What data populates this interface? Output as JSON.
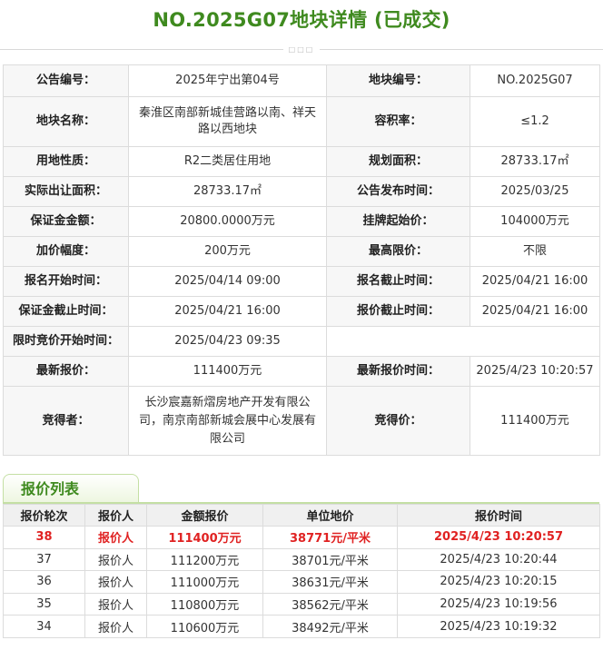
{
  "page": {
    "title": "NO.2025G07地块详情 (已成交)"
  },
  "detail": {
    "announcement_no_label": "公告编号：",
    "announcement_no": "2025年宁出第04号",
    "parcel_no_label": "地块编号：",
    "parcel_no": "NO.2025G07",
    "parcel_name_label": "地块名称：",
    "parcel_name": "秦淮区南部新城佳营路以南、祥天路以西地块",
    "plot_ratio_label": "容积率：",
    "plot_ratio": "≤1.2",
    "land_use_label": "用地性质：",
    "land_use": "R2二类居住用地",
    "planned_area_label": "规划面积：",
    "planned_area": "28733.17㎡",
    "actual_area_label": "实际出让面积：",
    "actual_area": "28733.17㎡",
    "publish_time_label": "公告发布时间：",
    "publish_time": "2025/03/25",
    "deposit_label": "保证金金额：",
    "deposit": "20800.0000万元",
    "start_price_label": "挂牌起始价：",
    "start_price": "104000万元",
    "increment_label": "加价幅度：",
    "increment": "200万元",
    "max_price_label": "最高限价：",
    "max_price": "不限",
    "reg_start_label": "报名开始时间：",
    "reg_start": "2025/04/14 09:00",
    "reg_end_label": "报名截止时间：",
    "reg_end": "2025/04/21 16:00",
    "deposit_end_label": "保证金截止时间：",
    "deposit_end": "2025/04/21 16:00",
    "quote_end_label": "报价截止时间：",
    "quote_end": "2025/04/21 16:00",
    "auction_start_label": "限时竞价开始时间：",
    "auction_start": "2025/04/23 09:35",
    "latest_price_label": "最新报价：",
    "latest_price": "111400万元",
    "latest_time_label": "最新报价时间：",
    "latest_time": "2025/4/23 10:20:57",
    "winner_label": "竞得者：",
    "winner": "长沙宸嘉新熠房地产开发有限公司，南京南部新城会展中心发展有限公司",
    "win_price_label": "竞得价：",
    "win_price": "111400万元"
  },
  "bids": {
    "section_title": "报价列表",
    "headers": [
      "报价轮次",
      "报价人",
      "金额报价",
      "单位地价",
      "报价时间"
    ],
    "rows": [
      [
        "38",
        "报价人",
        "111400万元",
        "38771元/平米",
        "2025/4/23 10:20:57"
      ],
      [
        "37",
        "报价人",
        "111200万元",
        "38701元/平米",
        "2025/4/23 10:20:44"
      ],
      [
        "36",
        "报价人",
        "111000万元",
        "38631元/平米",
        "2025/4/23 10:20:15"
      ],
      [
        "35",
        "报价人",
        "110800万元",
        "38562元/平米",
        "2025/4/23 10:19:56"
      ],
      [
        "34",
        "报价人",
        "110600万元",
        "38492元/平米",
        "2025/4/23 10:19:32"
      ]
    ]
  },
  "colors": {
    "accent_green": "#3f8a1f",
    "highlight_red": "#e02222",
    "label_bg": "#f7f7f7",
    "border": "#dcdcdc"
  }
}
